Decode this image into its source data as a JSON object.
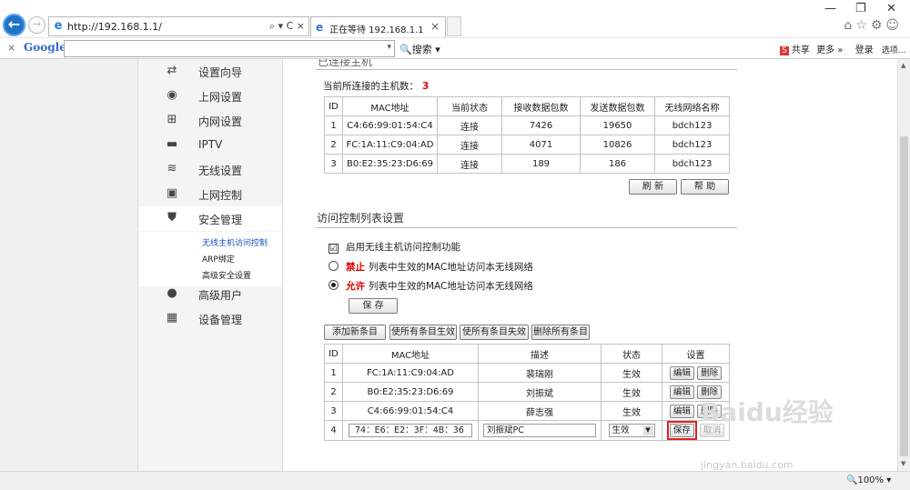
{
  "browser": {
    "url": "http://192.168.1.1/",
    "address_controls": "⌕ ▾ C ×",
    "tab_title": "正在等待 192.168.1.1",
    "tab_close": "×",
    "back": "←",
    "forward": "→",
    "minimize": "—",
    "restore": "❐",
    "close": "✕",
    "right_icons": "⌂☆⚙☺"
  },
  "google_toolbar": {
    "close": "×",
    "logo": "Google",
    "search_value": "",
    "search_button": "🔍搜索 ▾",
    "share": "共享",
    "more": "更多 »",
    "login": "登录",
    "options": "选项..."
  },
  "sidebar": {
    "items": [
      {
        "label": "设置向导",
        "icon": "swap-icon"
      },
      {
        "label": "上网设置",
        "icon": "globe-icon"
      },
      {
        "label": "内网设置",
        "icon": "network-icon"
      },
      {
        "label": "IPTV",
        "icon": "tv-icon"
      },
      {
        "label": "无线设置",
        "icon": "wifi-icon"
      },
      {
        "label": "上网控制",
        "icon": "lock-icon"
      },
      {
        "label": "安全管理",
        "icon": "shield-icon"
      },
      {
        "label": "高级用户",
        "icon": "user-icon"
      },
      {
        "label": "设备管理",
        "icon": "grid-icon"
      }
    ],
    "sub_items": [
      "无线主机访问控制",
      "ARP绑定",
      "高级安全设置"
    ]
  },
  "connected": {
    "section_title": "已连接主机",
    "count_label": "当前所连接的主机数：",
    "count": "3",
    "headers": [
      "ID",
      "MAC地址",
      "当前状态",
      "接收数据包数",
      "发送数据包数",
      "无线网络名称"
    ],
    "rows": [
      [
        "1",
        "C4:66:99:01:54:C4",
        "连接",
        "7426",
        "19650",
        "bdch123"
      ],
      [
        "2",
        "FC:1A:11:C9:04:AD",
        "连接",
        "4071",
        "10826",
        "bdch123"
      ],
      [
        "3",
        "B0:E2:35:23:D6:69",
        "连接",
        "189",
        "186",
        "bdch123"
      ]
    ],
    "refresh_button": "刷 新",
    "help_button": "帮 助"
  },
  "acl": {
    "section_title": "访问控制列表设置",
    "enable_label": "启用无线主机访问控制功能",
    "enable_checked": "☑",
    "deny_keyword": "禁止",
    "deny_text": "列表中生效的MAC地址访问本无线网络",
    "allow_keyword": "允许",
    "allow_text": "列表中生效的MAC地址访问本无线网络",
    "save_button": "保 存",
    "toolbar": [
      "添加新条目",
      "使所有条目生效",
      "使所有条目失效",
      "删除所有条目"
    ],
    "headers": [
      "ID",
      "MAC地址",
      "描述",
      "状态",
      "设置"
    ],
    "rows": [
      {
        "id": "1",
        "mac": "FC:1A:11:C9:04:AD",
        "desc": "裴瑞刚",
        "status": "生效"
      },
      {
        "id": "2",
        "mac": "B0:E2:35:23:D6:69",
        "desc": "刘振斌",
        "status": "生效"
      },
      {
        "id": "3",
        "mac": "C4:66:99:01:54:C4",
        "desc": "薛志强",
        "status": "生效"
      }
    ],
    "edit_label": "编辑",
    "delete_label": "删除",
    "new_row": {
      "id": "4",
      "mac": "74：E6：E2：3F：4B：36",
      "desc": "刘振斌PC",
      "status": "生效",
      "save": "保存",
      "cancel": "取消"
    }
  },
  "status_bar": {
    "zoom": "🔍100%  ▾"
  },
  "watermark": {
    "text": "Baidu经验",
    "sub": "jingyan.baidu.com"
  }
}
